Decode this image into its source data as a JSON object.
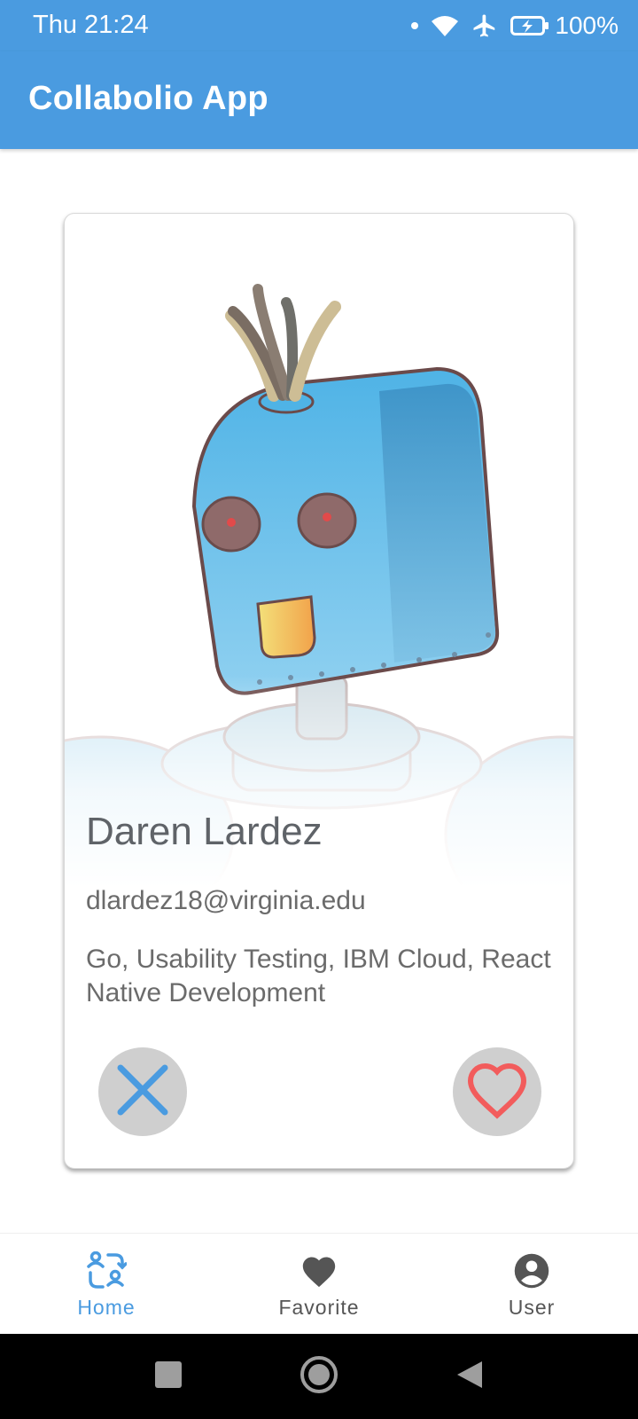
{
  "status_bar": {
    "time": "Thu 21:24",
    "battery": "100%",
    "icons": [
      "notification-dot-icon",
      "wifi-icon",
      "airplane-icon",
      "battery-charging-icon"
    ]
  },
  "app_bar": {
    "title": "Collabolio App"
  },
  "profile_card": {
    "name": "Daren Lardez",
    "email": "dlardez18@virginia.edu",
    "skills": "Go, Usability Testing, IBM Cloud, React Native Development",
    "reject_icon": "close-icon",
    "like_icon": "heart-outline-icon"
  },
  "bottom_nav": {
    "items": [
      {
        "label": "Home",
        "icon": "people-swap-icon",
        "active": true
      },
      {
        "label": "Favorite",
        "icon": "heart-icon",
        "active": false
      },
      {
        "label": "User",
        "icon": "account-circle-icon",
        "active": false
      }
    ]
  },
  "colors": {
    "primary": "#4a9be0",
    "reject": "#4a9be0",
    "like": "#f25c5c",
    "button_bg": "#cfcfcf"
  }
}
